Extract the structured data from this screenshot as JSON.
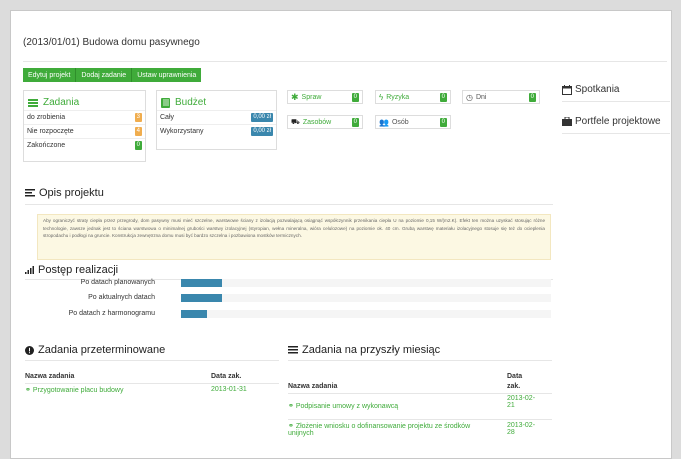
{
  "project_title": "(2013/01/01) Budowa domu pasywnego",
  "toolbar": {
    "edit": "Edytuj projekt",
    "add_task": "Dodaj zadanie",
    "permissions": "Ustaw uprawnienia"
  },
  "tasks_box": {
    "title": "Zadania",
    "rows": [
      {
        "label": "do zrobienia",
        "value": "3"
      },
      {
        "label": "Nie rozpoczęte",
        "value": "4"
      },
      {
        "label": "Zakończone",
        "value": "0"
      }
    ]
  },
  "budget_box": {
    "title": "Budżet",
    "rows": [
      {
        "label": "Cały",
        "value": "0,00 zł"
      },
      {
        "label": "Wykorzystany",
        "value": "0,00 zł"
      }
    ]
  },
  "stats": {
    "spraw": {
      "label": "Spraw",
      "value": "0"
    },
    "ryzyka": {
      "label": "Ryzyka",
      "value": "0"
    },
    "dni": {
      "label": "Dni",
      "value": "0"
    },
    "zasobow": {
      "label": "Zasobów",
      "value": "0"
    },
    "osob": {
      "label": "Osób",
      "value": "0"
    }
  },
  "sidebar": {
    "meetings": "Spotkania",
    "portfolios": "Portfele projektowe"
  },
  "description": {
    "title": "Opis projektu",
    "text": "Aby ograniczyć straty ciepła przez przegrody, dom pasywny musi mieć szczelne, warstwowe ściany z izolacją pozwalającą osiągnąć współczynnik przenikania ciepła U na poziomie 0,15 W/(m2.K). Efekt ten można uzyskać stosując różne technologie, zawsze jednak jest to ściana warstwowa o minimalnej grubości warstwy izolacyjnej (styropian, wełna mineralna, wióra celulozowe) na poziomie ok. 40 cm. Grubą warstwę materiału izolacyjnego stosuje się też do ocieplenia stropodachu i podłogi na gruncie. Konstrukcja zewnętrzna domu musi być bardzo szczelna i pozbawiona mostków termicznych."
  },
  "progress": {
    "title": "Postęp realizacji",
    "bars": [
      {
        "label": "Po datach planowanych",
        "fraction": 0.11
      },
      {
        "label": "Po aktualnych datach",
        "fraction": 0.11
      },
      {
        "label": "Po datach z harmonogramu",
        "fraction": 0.07
      }
    ]
  },
  "overdue": {
    "title": "Zadania przeterminowane",
    "col_name": "Nazwa zadania",
    "col_date": "Data zak.",
    "rows": [
      {
        "name": "Przygotowanie placu budowy",
        "date": "2013-01-31"
      }
    ]
  },
  "next_month": {
    "title": "Zadania na przyszły miesiąc",
    "col_name": "Nazwa zadania",
    "col_date_1": "Data",
    "col_date_2": "zak.",
    "rows": [
      {
        "name": "Podpisanie umowy z wykonawcą",
        "date_1": "2013-02-",
        "date_2": "21"
      },
      {
        "name_1": "Złożenie wniosku o dofinansowanie projektu ze środków",
        "name_2": "unijnych",
        "date_1": "2013-02-",
        "date_2": "28"
      }
    ]
  },
  "colors": {
    "accent_green": "#3fab3a",
    "badge_orange": "#f0ad4e",
    "badge_blue": "#3a87ad",
    "description_bg": "#fcf8e3"
  }
}
